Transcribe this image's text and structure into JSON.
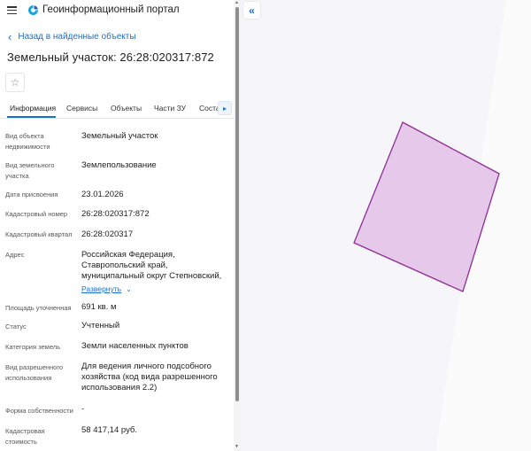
{
  "header": {
    "menu_icon": "menu-icon",
    "logo_icon": "portal-logo-icon",
    "title": "Геоинформационный портал"
  },
  "back_link": {
    "label": "Назад в найденные объекты"
  },
  "page_title": "Земельный участок: 26:28:020317:872",
  "favorite_icon": "star-icon",
  "tabs": [
    {
      "label": "Информация",
      "active": true
    },
    {
      "label": "Сервисы"
    },
    {
      "label": "Объекты"
    },
    {
      "label": "Части ЗУ"
    },
    {
      "label": "Состав"
    }
  ],
  "tab_next_icon": "chevron-right-icon",
  "details": [
    {
      "label": "Вид объекта недвижимости",
      "value": "Земельный участок"
    },
    {
      "label": "Вид земельного участка",
      "value": "Землепользование"
    },
    {
      "label": "Дата присвоения",
      "value": "23.01.2026"
    },
    {
      "label": "Кадастровый номер",
      "value": "26:28:020317:872"
    },
    {
      "label": "Кадастровый квартал",
      "value": "26:28:020317"
    },
    {
      "label": "Адрес",
      "value": "Российская Федерация, Ставропольский край, муниципальный округ Степновский,"
    },
    {
      "label": "Площадь уточненная",
      "value": "691 кв. м"
    },
    {
      "label": "Статус",
      "value": "Учтенный"
    },
    {
      "label": "Категория земель",
      "value": "Земли населенных пунктов"
    },
    {
      "label": "Вид разрешенного использования",
      "value": "Для ведения личного подсобного хозяйства (код вида разрешенного использования 2.2)"
    },
    {
      "label": "Форма собственности",
      "value": "-"
    },
    {
      "label": "Кадастровая стоимость",
      "value": "58 417,14 руб."
    }
  ],
  "address_expand": {
    "label": "Развернуть",
    "icon": "chevron-down-icon"
  },
  "map": {
    "collapse_icon": "double-chevron-left-icon",
    "parcel_fill": "#e6c8ea",
    "parcel_stroke": "#8e2d96",
    "background": "#f6f5f9"
  },
  "colors": {
    "accent": "#1a6fc9"
  }
}
